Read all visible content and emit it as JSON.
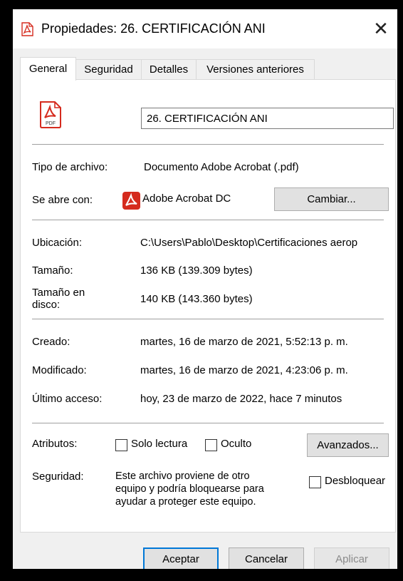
{
  "window": {
    "title": "Propiedades: 26. CERTIFICACIÓN ANI",
    "close_glyph": "✕"
  },
  "tabs": [
    {
      "label": "General",
      "active": true
    },
    {
      "label": "Seguridad",
      "active": false
    },
    {
      "label": "Detalles",
      "active": false
    },
    {
      "label": "Versiones anteriores",
      "active": false
    }
  ],
  "file": {
    "name": "26. CERTIFICACIÓN ANI",
    "icon_text": "PDF"
  },
  "type_section": {
    "type_label": "Tipo de archivo:",
    "type_value": "Documento Adobe Acrobat (.pdf)",
    "opens_label": "Se abre con:",
    "opens_value": "Adobe Acrobat DC",
    "change_button": "Cambiar..."
  },
  "location_section": {
    "location_label": "Ubicación:",
    "location_value": "C:\\Users\\Pablo\\Desktop\\Certificaciones aerop",
    "size_label": "Tamaño:",
    "size_value": "136 KB (139.309 bytes)",
    "disk_size_label_1": "Tamaño en",
    "disk_size_label_2": "disco:",
    "disk_size_value": "140 KB (143.360 bytes)"
  },
  "dates_section": {
    "created_label": "Creado:",
    "created_value": "martes, 16 de marzo de 2021, 5:52:13 p. m.",
    "modified_label": "Modificado:",
    "modified_value": "martes, 16 de marzo de 2021, 4:23:06 p. m.",
    "accessed_label": "Último acceso:",
    "accessed_value": "hoy, 23 de marzo de 2022, hace 7 minutos"
  },
  "attributes_section": {
    "attributes_label": "Atributos:",
    "readonly_label": "Solo lectura",
    "readonly_checked": false,
    "hidden_label": "Oculto",
    "hidden_checked": false,
    "advanced_button": "Avanzados...",
    "security_label": "Seguridad:",
    "security_text_1": "Este archivo proviene de otro",
    "security_text_2": "equipo y podría bloquearse para",
    "security_text_3": "ayudar a proteger este equipo.",
    "unblock_label": "Desbloquear",
    "unblock_checked": false
  },
  "footer": {
    "ok_button": "Aceptar",
    "cancel_button": "Cancelar",
    "apply_button": "Aplicar"
  },
  "colors": {
    "accent": "#0078d7",
    "pdf_red": "#d52b1e"
  }
}
